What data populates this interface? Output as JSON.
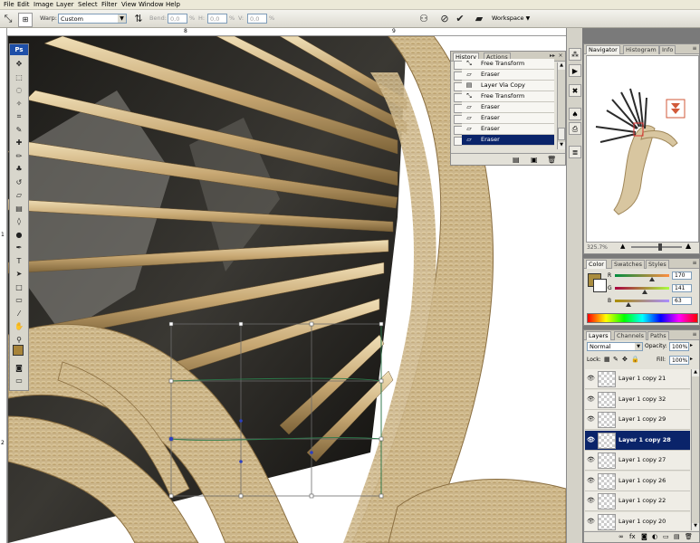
{
  "menu": [
    "File",
    "Edit",
    "Image",
    "Layer",
    "Select",
    "Filter",
    "View",
    "Window",
    "Help"
  ],
  "options": {
    "warp_label": "Warp:",
    "warp_value": "Custom",
    "bend_label": "Bend:",
    "bend_value": "0,0",
    "h_label": "H:",
    "h_value": "0,0",
    "v_label": "V:",
    "v_value": "0,0",
    "pct": "%",
    "workspace_label": "Workspace"
  },
  "ruler": {
    "top_marks": [
      "8",
      "9"
    ],
    "left_marks": [
      "1",
      "2"
    ]
  },
  "toolbox": {
    "logo": "Ps",
    "tools": [
      {
        "icon": "move-icon",
        "glyph": "✥"
      },
      {
        "icon": "marquee-icon",
        "glyph": "⬚"
      },
      {
        "icon": "lasso-icon",
        "glyph": "◌"
      },
      {
        "icon": "magic-wand-icon",
        "glyph": "✧"
      },
      {
        "icon": "crop-icon",
        "glyph": "⌗"
      },
      {
        "icon": "slice-icon",
        "glyph": "✎"
      },
      {
        "icon": "healing-brush-icon",
        "glyph": "✚"
      },
      {
        "icon": "brush-icon",
        "glyph": "✏"
      },
      {
        "icon": "clone-stamp-icon",
        "glyph": "♣"
      },
      {
        "icon": "history-brush-icon",
        "glyph": "↺"
      },
      {
        "icon": "eraser-icon",
        "glyph": "▱"
      },
      {
        "icon": "gradient-icon",
        "glyph": "▤"
      },
      {
        "icon": "blur-icon",
        "glyph": "◊"
      },
      {
        "icon": "dodge-icon",
        "glyph": "●"
      },
      {
        "icon": "pen-icon",
        "glyph": "✒"
      },
      {
        "icon": "type-icon",
        "glyph": "T"
      },
      {
        "icon": "path-selection-icon",
        "glyph": "➤"
      },
      {
        "icon": "shape-icon",
        "glyph": "□"
      },
      {
        "icon": "notes-icon",
        "glyph": "▭"
      },
      {
        "icon": "eyedropper-icon",
        "glyph": "⁄"
      },
      {
        "icon": "hand-icon",
        "glyph": "✋"
      },
      {
        "icon": "zoom-icon",
        "glyph": "⚲"
      }
    ],
    "foreground_color": "#a8843a",
    "background_color": "#ffffff"
  },
  "history": {
    "tabs": [
      "History",
      "Actions"
    ],
    "rows": [
      {
        "label": "Free Transform",
        "icon": "transform-icon",
        "selected": false
      },
      {
        "label": "Eraser",
        "icon": "eraser-icon",
        "selected": false
      },
      {
        "label": "Layer Via Copy",
        "icon": "layer-copy-icon",
        "selected": false
      },
      {
        "label": "Free Transform",
        "icon": "transform-icon",
        "selected": false
      },
      {
        "label": "Eraser",
        "icon": "eraser-icon",
        "selected": false
      },
      {
        "label": "Eraser",
        "icon": "eraser-icon",
        "selected": false
      },
      {
        "label": "Eraser",
        "icon": "eraser-icon",
        "selected": false
      },
      {
        "label": "Eraser",
        "icon": "eraser-icon",
        "selected": true
      }
    ]
  },
  "navigator": {
    "tabs": [
      "Navigator",
      "Histogram",
      "Info"
    ],
    "zoom": "325.7%"
  },
  "color": {
    "tabs": [
      "Color",
      "Swatches",
      "Styles"
    ],
    "channels": [
      {
        "label": "R",
        "value": "170"
      },
      {
        "label": "G",
        "value": "141"
      },
      {
        "label": "B",
        "value": "63"
      }
    ],
    "swatch": "#aa8d3f"
  },
  "layers": {
    "tabs": [
      "Layers",
      "Channels",
      "Paths"
    ],
    "blend_mode": "Normal",
    "opacity_label": "Opacity:",
    "opacity_value": "100%",
    "lock_label": "Lock:",
    "fill_label": "Fill:",
    "fill_value": "100%",
    "items": [
      {
        "name": "Layer 1 copy 21",
        "selected": false
      },
      {
        "name": "Layer 1 copy 32",
        "selected": false
      },
      {
        "name": "Layer 1 copy 29",
        "selected": false
      },
      {
        "name": "Layer 1 copy 28",
        "selected": true
      },
      {
        "name": "Layer 1 copy 27",
        "selected": false
      },
      {
        "name": "Layer 1 copy 26",
        "selected": false
      },
      {
        "name": "Layer 1 copy 22",
        "selected": false
      },
      {
        "name": "Layer 1 copy 20",
        "selected": false
      }
    ]
  }
}
